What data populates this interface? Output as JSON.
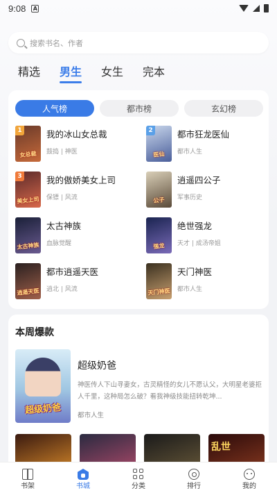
{
  "status_bar": {
    "time": "9:08",
    "notif_letter": "A"
  },
  "search": {
    "placeholder": "搜索书名、作者"
  },
  "category_tabs": [
    {
      "label": "精选",
      "active": false
    },
    {
      "label": "男生",
      "active": true
    },
    {
      "label": "女生",
      "active": false
    },
    {
      "label": "完本",
      "active": false
    }
  ],
  "ranking": {
    "sub_tabs": [
      {
        "label": "人气榜",
        "active": true
      },
      {
        "label": "都市榜",
        "active": false
      },
      {
        "label": "玄幻榜",
        "active": false
      }
    ],
    "books": [
      {
        "rank": "1",
        "title": "我的冰山女总裁",
        "meta": "鼓捣 | 神医",
        "cover_colors": [
          "#6a3a2a",
          "#c76a3a"
        ],
        "cover_text": "女总裁"
      },
      {
        "rank": "2",
        "title": "都市狂龙医仙",
        "meta": "都市人生",
        "cover_colors": [
          "#c9d7ec",
          "#4a5e9a"
        ],
        "cover_text": "医仙"
      },
      {
        "rank": "3",
        "title": "我的傲娇美女上司",
        "meta": "保镖 | 风流",
        "cover_colors": [
          "#5a2a2a",
          "#d8684a"
        ],
        "cover_text": "美女上司"
      },
      {
        "rank": "",
        "title": "逍遥四公子",
        "meta": "军事历史",
        "cover_colors": [
          "#d9cfb8",
          "#5a4a38"
        ],
        "cover_text": "公子"
      },
      {
        "rank": "",
        "title": "太古神族",
        "meta": "血脉觉醒",
        "cover_colors": [
          "#1a2038",
          "#6a5a90"
        ],
        "cover_text": "太古神族"
      },
      {
        "rank": "",
        "title": "绝世强龙",
        "meta": "天才 | 成汤帝姐",
        "cover_colors": [
          "#1a2450",
          "#7a6ab8"
        ],
        "cover_text": "强龙"
      },
      {
        "rank": "",
        "title": "都市逍遥天医",
        "meta": "逍北 | 风流",
        "cover_colors": [
          "#2a2020",
          "#a0604a"
        ],
        "cover_text": "逍遥天医"
      },
      {
        "rank": "",
        "title": "天门神医",
        "meta": "都市人生",
        "cover_colors": [
          "#3a3020",
          "#c8a070"
        ],
        "cover_text": "天门神医"
      }
    ],
    "badge_colors": {
      "1": "#f2a53a",
      "2": "#5aa0e8",
      "3": "#f07a3a"
    }
  },
  "weekly": {
    "title": "本周爆款",
    "featured": {
      "name": "超级奶爸",
      "cover_text": "超级奶爸",
      "description": "神医传人下山寻妻女，古灵精怪的女儿不愿认父，大明星老婆拒人千里，这种局怎么破？看我神级技能扭转乾坤...",
      "category": "都市人生"
    },
    "thumbs": [
      {
        "colors": [
          "#3a1a10",
          "#d88a2a"
        ],
        "text": ""
      },
      {
        "colors": [
          "#2a2a40",
          "#b04a6a"
        ],
        "text": ""
      },
      {
        "colors": [
          "#1a1a1a",
          "#6a5a3a"
        ],
        "text": ""
      },
      {
        "colors": [
          "#2a0a0a",
          "#8a3a20"
        ],
        "text": "乱世"
      }
    ]
  },
  "bottom_nav": [
    {
      "label": "书架",
      "icon": "bookshelf-icon",
      "active": false
    },
    {
      "label": "书城",
      "icon": "bookstore-icon",
      "active": true
    },
    {
      "label": "分类",
      "icon": "category-grid-icon",
      "active": false
    },
    {
      "label": "排行",
      "icon": "rank-medal-icon",
      "active": false
    },
    {
      "label": "我的",
      "icon": "profile-face-icon",
      "active": false
    }
  ]
}
